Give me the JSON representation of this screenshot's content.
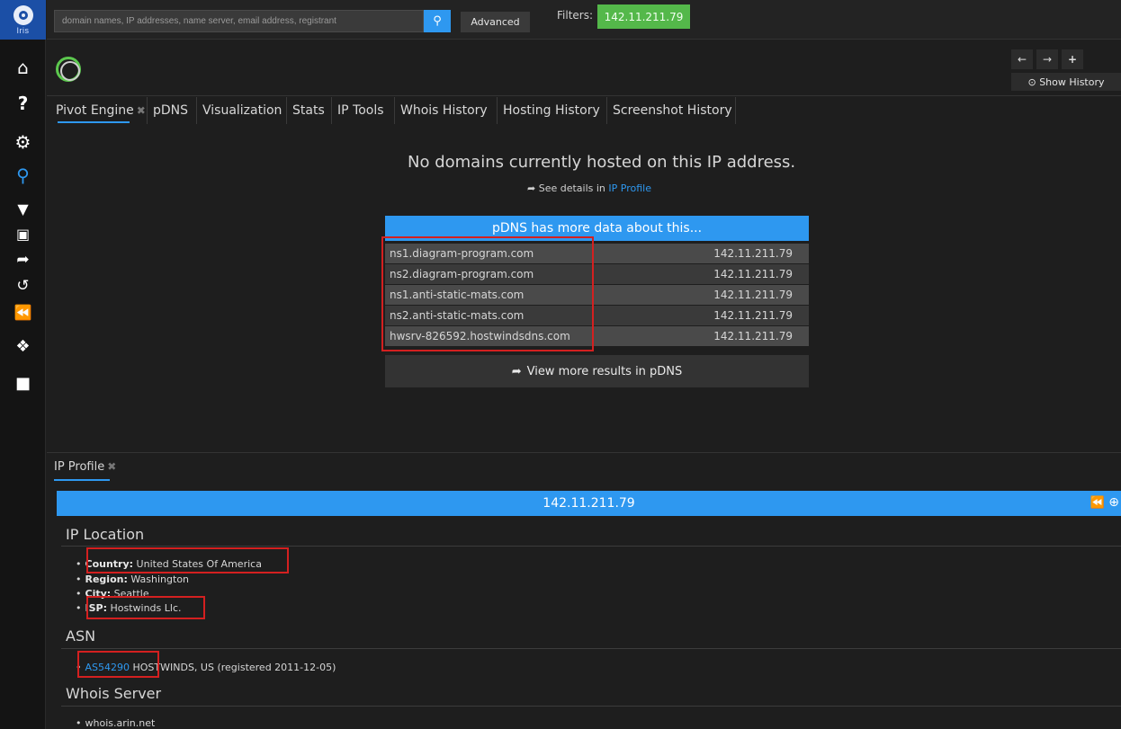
{
  "app": {
    "logo_text": "Iris"
  },
  "sidebar": {
    "icons": [
      "home-icon",
      "help-icon",
      "gear-icon",
      "search-icon",
      "filter-icon",
      "note-icon",
      "share-icon",
      "history-icon",
      "pin-icon",
      "tags-icon",
      "folder-icon"
    ]
  },
  "search": {
    "placeholder": "domain names, IP addresses, name server, email address, registrant",
    "advanced_label": "Advanced",
    "filters_label": "Filters:",
    "filter_value": "142.11.211.79"
  },
  "history": {
    "show_history_label": "⊙ Show History"
  },
  "tabs": [
    {
      "label": "Pivot Engine",
      "closable": true
    },
    {
      "label": "pDNS"
    },
    {
      "label": "Visualization"
    },
    {
      "label": "Stats"
    },
    {
      "label": "IP Tools"
    },
    {
      "label": "Whois History"
    },
    {
      "label": "Hosting History"
    },
    {
      "label": "Screenshot History"
    }
  ],
  "pivot": {
    "message": "No domains currently hosted on this IP address.",
    "see_details_prefix": "See details in",
    "see_details_link": "IP Profile",
    "pdns_header": "pDNS has more data about this...",
    "rows": [
      {
        "host": "ns1.diagram-program.com",
        "ip": "142.11.211.79"
      },
      {
        "host": "ns2.diagram-program.com",
        "ip": "142.11.211.79"
      },
      {
        "host": "ns1.anti-static-mats.com",
        "ip": "142.11.211.79"
      },
      {
        "host": "ns2.anti-static-mats.com",
        "ip": "142.11.211.79"
      },
      {
        "host": "hwsrv-826592.hostwindsdns.com",
        "ip": "142.11.211.79"
      }
    ],
    "view_more": "View more results in pDNS"
  },
  "profile": {
    "tab_label": "IP Profile",
    "ip": "142.11.211.79",
    "location_title": "IP Location",
    "country_label": "Country:",
    "country": "United States Of America",
    "region_label": "Region:",
    "region": "Washington",
    "city_label": "City:",
    "city": "Seattle",
    "isp_label": "ISP:",
    "isp": "Hostwinds Llc.",
    "asn_title": "ASN",
    "asn_link": "AS54290",
    "asn_text": "HOSTWINDS, US (registered 2011-12-05)",
    "whois_title": "Whois Server",
    "whois_server": "whois.arin.net"
  },
  "colors": {
    "accent": "#2e98f0",
    "filter_green": "#54b84a",
    "highlight_red": "#d42020"
  }
}
